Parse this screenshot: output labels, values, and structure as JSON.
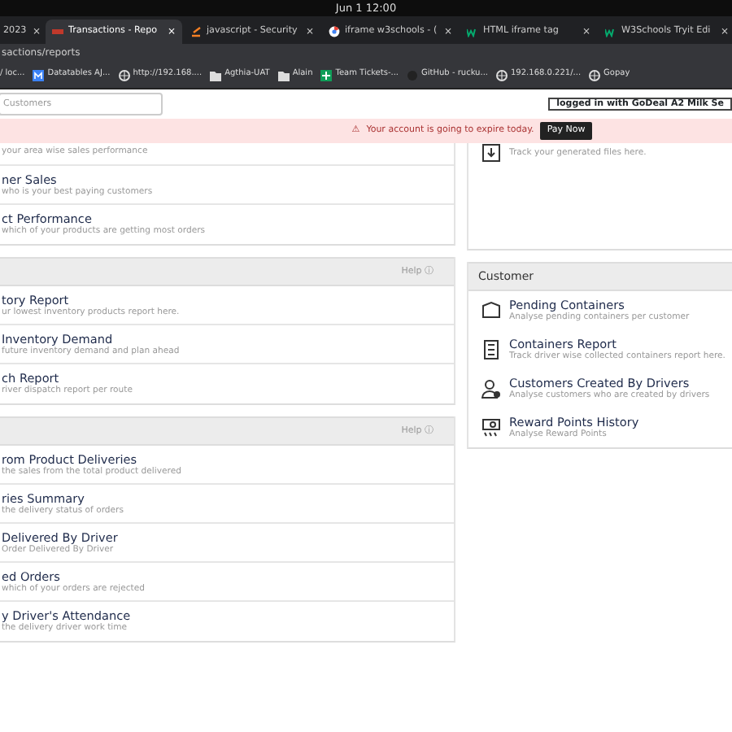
{
  "clock": "Jun 1 12:00",
  "tabs": [
    {
      "label": "2023",
      "selected": false,
      "close": "×"
    },
    {
      "label": "Transactions - Repo",
      "selected": true,
      "close": "×"
    },
    {
      "label": "javascript - Security",
      "selected": false,
      "close": "×"
    },
    {
      "label": "iframe w3schools - (",
      "selected": false,
      "close": "×"
    },
    {
      "label": "HTML iframe tag",
      "selected": false,
      "close": "×"
    },
    {
      "label": "W3Schools Tryit Edi",
      "selected": false,
      "close": "×"
    }
  ],
  "address": "sactions/reports",
  "bookmarks": [
    "/ loc...",
    "Datatables AJ...",
    "http://192.168....",
    "Agthia-UAT",
    "Alain",
    "Team Tickets-...",
    "GitHub - rucku...",
    "192.168.0.221/...",
    "Gopay"
  ],
  "search": {
    "placeholder": "Customers"
  },
  "login": "logged in with GoDeal A2 Milk Se",
  "alert": {
    "icon": "⚠",
    "text": "Your account is going to expire today.",
    "button": "Pay Now"
  },
  "sections": [
    {
      "items": [
        {
          "desc": "your area wise sales performance"
        },
        {
          "title": "ner Sales",
          "desc": "who is your best paying customers"
        },
        {
          "title": "ct Performance",
          "desc": "which of your products are getting most orders"
        }
      ]
    },
    {
      "header": "Help ⓘ",
      "items": [
        {
          "title": "tory Report",
          "desc": "ur lowest inventory products report here."
        },
        {
          "title": "Inventory Demand",
          "desc": "future inventory demand and plan ahead"
        },
        {
          "title": "ch Report",
          "desc": "river dispatch report per route"
        }
      ]
    },
    {
      "header": "Help ⓘ",
      "items": [
        {
          "title": "rom Product Deliveries",
          "desc": "the sales from the total product delivered"
        },
        {
          "title": "ries Summary",
          "desc": "the delivery status of orders"
        },
        {
          "title": "Delivered By Driver",
          "desc": "Order Delivered By Driver"
        },
        {
          "title": "ed Orders",
          "desc": "which of your orders are rejected"
        },
        {
          "title": "y Driver's Attendance",
          "desc": "the delivery driver work time"
        }
      ]
    }
  ],
  "right": [
    {
      "items": [
        {
          "desc": "Track your generated files here."
        }
      ]
    },
    {
      "header": "Customer",
      "items": [
        {
          "title": "Pending Containers",
          "desc": "Analyse pending containers per customer"
        },
        {
          "title": "Containers Report",
          "desc": "Track driver wise collected containers report here."
        },
        {
          "title": "Customers Created By Drivers",
          "desc": "Analyse customers who are created by drivers"
        },
        {
          "title": "Reward Points History",
          "desc": "Analyse Reward Points"
        }
      ]
    }
  ]
}
